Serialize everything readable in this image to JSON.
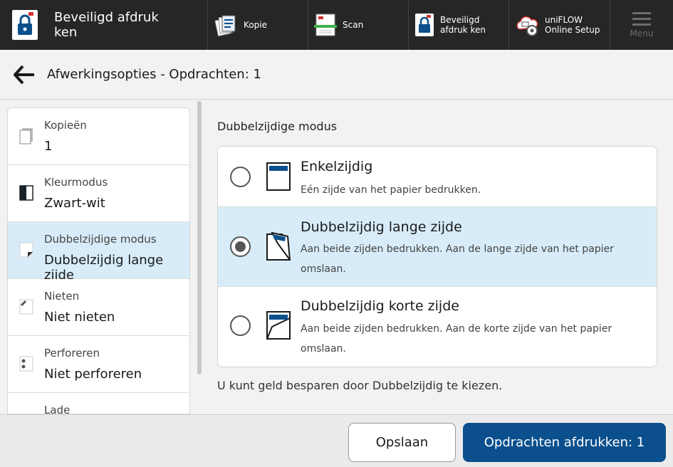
{
  "topbar": {
    "app_title": "Beveiligd afdruk ken",
    "nav": [
      {
        "label": "Kopie",
        "icon": "copy-icon"
      },
      {
        "label": "Scan",
        "icon": "scan-icon"
      },
      {
        "label": "Beveiligd afdruk ken",
        "icon": "secure-print-icon"
      },
      {
        "label": "uniFLOW Online Setup",
        "icon": "cloud-settings-icon"
      }
    ],
    "menu_label": "Menu"
  },
  "header": {
    "title": "Afwerkingsopties - Opdrachten: 1"
  },
  "sidebar": {
    "items": [
      {
        "label": "Kopieën",
        "value": "1",
        "icon": "copies-icon"
      },
      {
        "label": "Kleurmodus",
        "value": "Zwart-wit",
        "icon": "color-mode-icon"
      },
      {
        "label": "Dubbelzijdige modus",
        "value": "Dubbelzijdig lange zijde",
        "icon": "duplex-icon",
        "active": true
      },
      {
        "label": "Nieten",
        "value": "Niet nieten",
        "icon": "staple-icon"
      },
      {
        "label": "Perforeren",
        "value": "Niet perforeren",
        "icon": "punch-icon"
      },
      {
        "label": "Lade",
        "value": "",
        "icon": "tray-icon"
      }
    ]
  },
  "main": {
    "section_title": "Dubbelzijdige modus",
    "options": [
      {
        "title": "Enkelzijdig",
        "desc": "Eén zijde van het papier bedrukken.",
        "selected": false
      },
      {
        "title": "Dubbelzijdig lange zijde",
        "desc": "Aan beide zijden bedrukken. Aan de lange zijde van het papier omslaan.",
        "selected": true
      },
      {
        "title": "Dubbelzijdig korte zijde",
        "desc": "Aan beide zijden bedrukken. Aan de korte zijde van het papier omslaan.",
        "selected": false
      }
    ],
    "hint": "U kunt geld besparen door Dubbelzijdig te kiezen."
  },
  "footer": {
    "save_label": "Opslaan",
    "print_label": "Opdrachten afdrukken: 1"
  },
  "colors": {
    "topbar": "#262626",
    "accent": "#0b4f8c",
    "selected": "#d7ecf8"
  }
}
